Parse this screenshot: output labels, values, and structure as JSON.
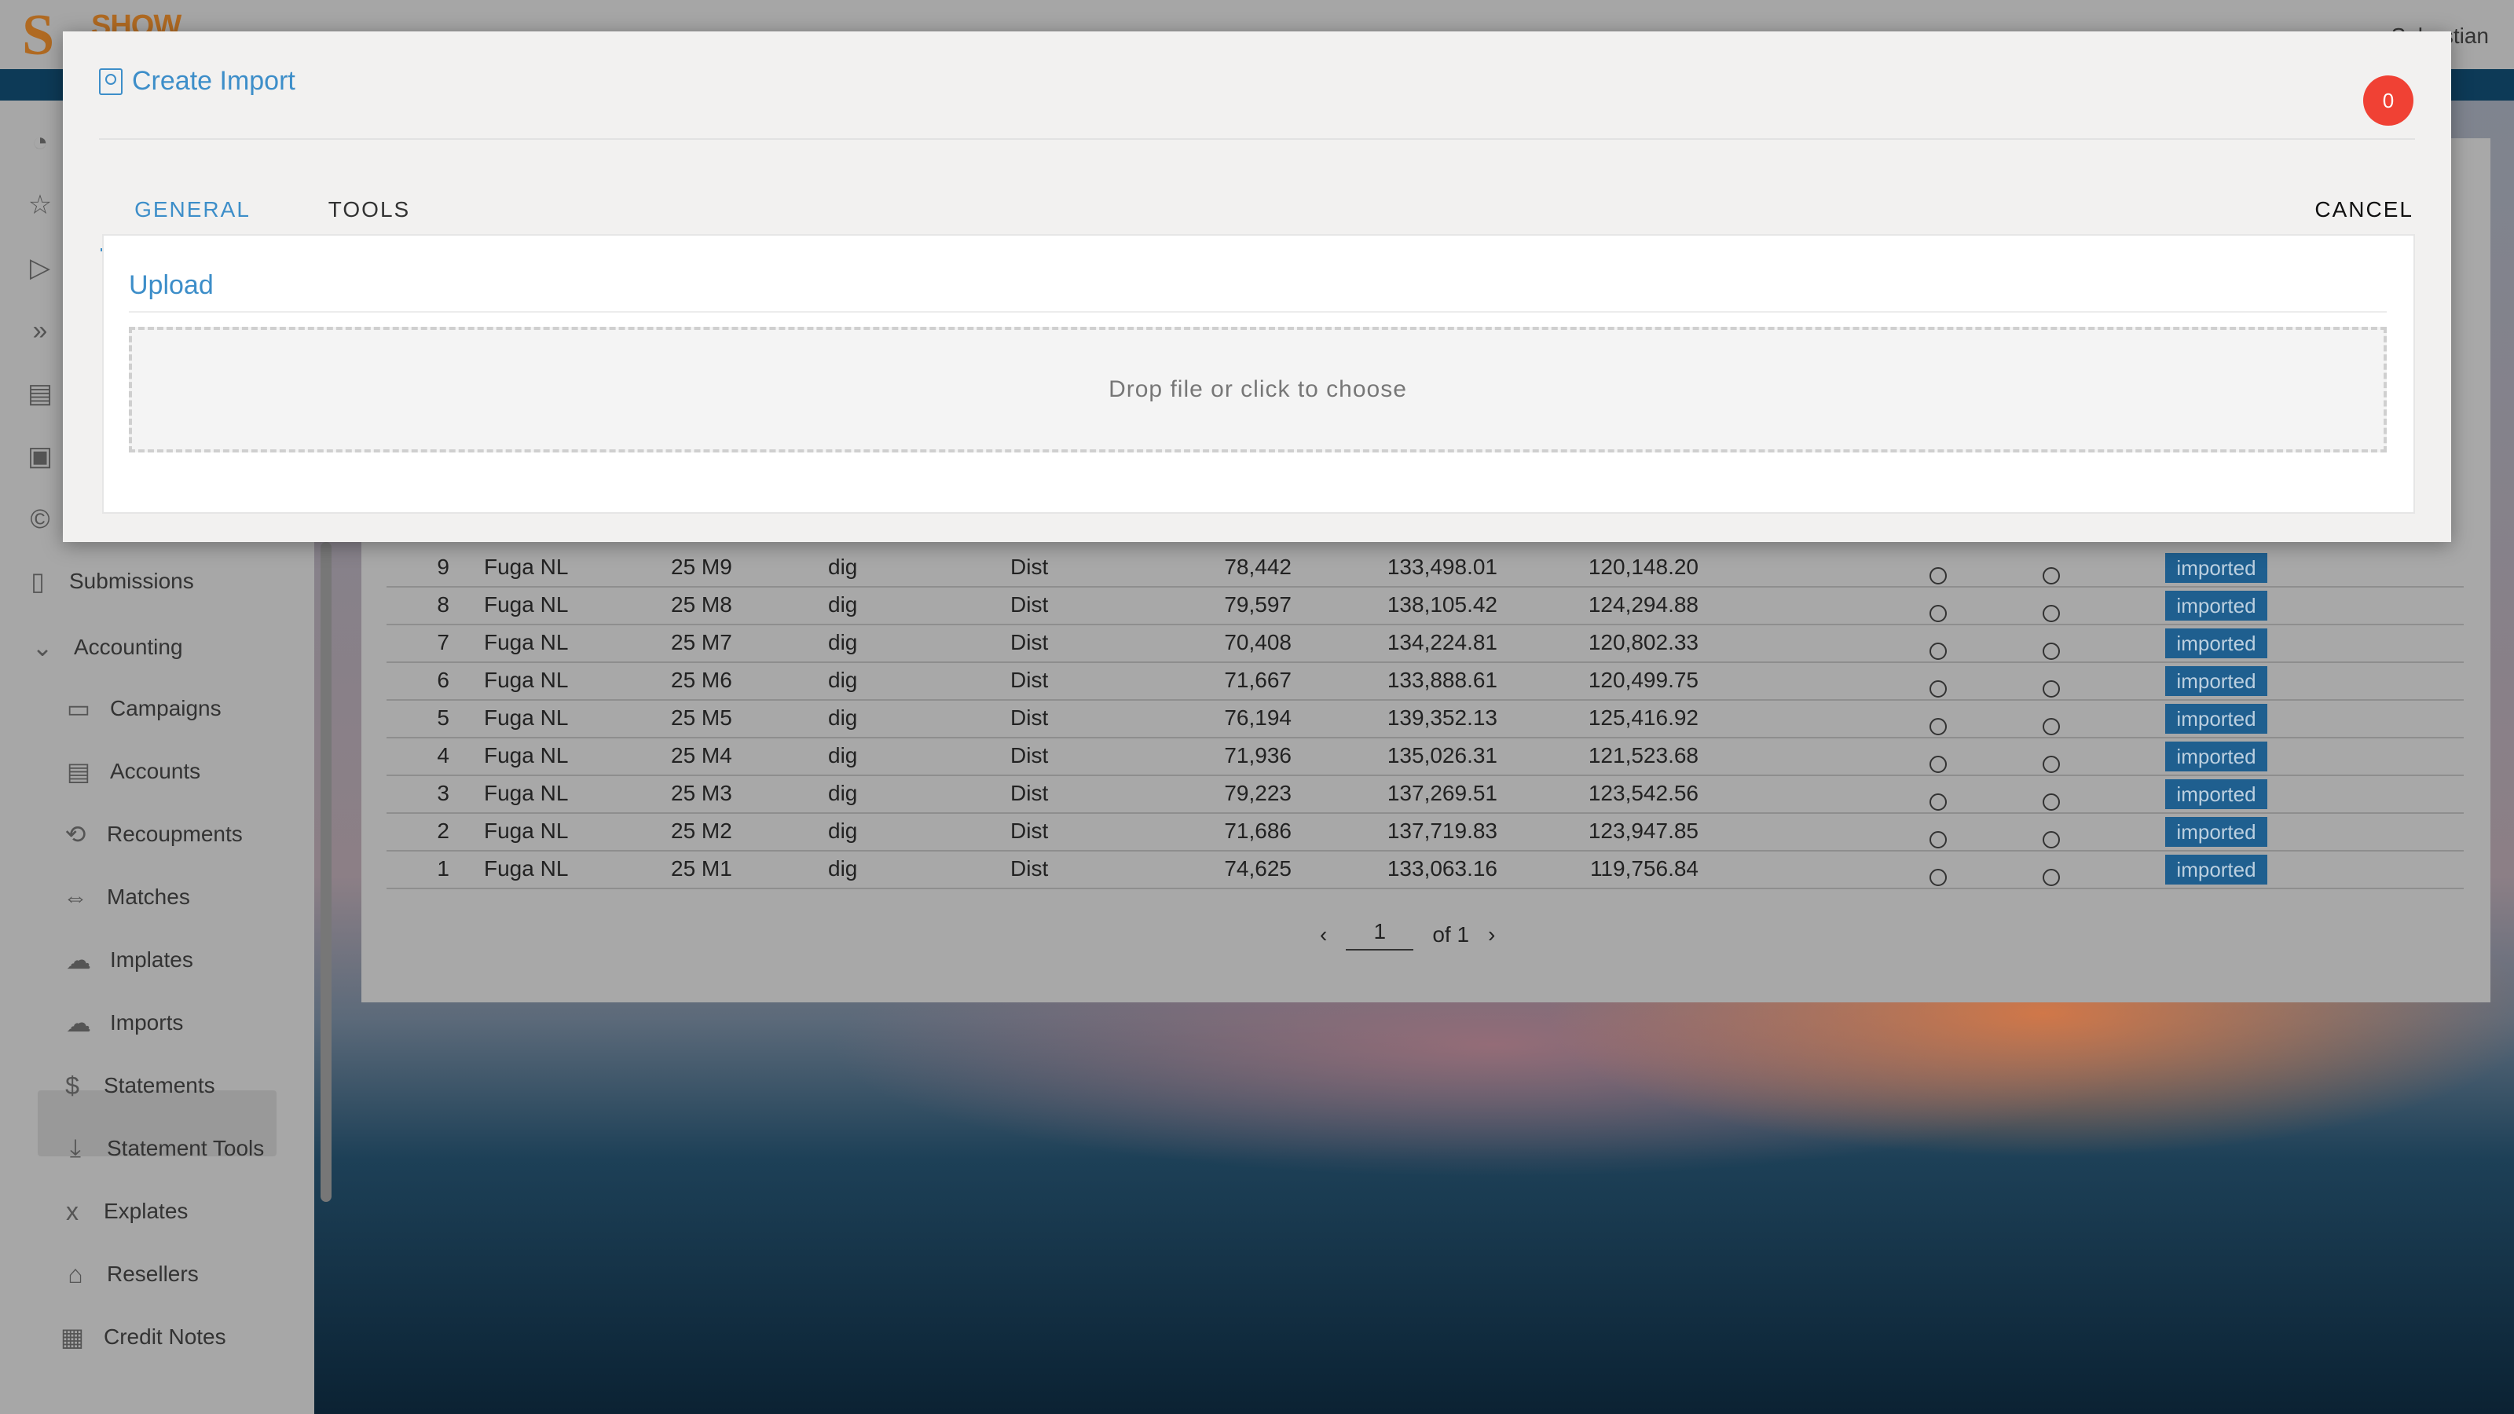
{
  "app": {
    "logo_letter": "S",
    "logo_text": "SHOW",
    "user_name": "Sebastian"
  },
  "sidebar": {
    "items": [
      {
        "label": "Submissions",
        "icon": "document-icon"
      },
      {
        "label": "Accounting",
        "icon": "chevron-down-icon"
      },
      {
        "label": "Campaigns",
        "icon": "monitor-icon"
      },
      {
        "label": "Accounts",
        "icon": "card-icon"
      },
      {
        "label": "Recoupments",
        "icon": "refresh-icon"
      },
      {
        "label": "Matches",
        "icon": "swap-icon"
      },
      {
        "label": "Implates",
        "icon": "cloud-download-icon"
      },
      {
        "label": "Imports",
        "icon": "cloud-download-icon"
      },
      {
        "label": "Statements",
        "icon": "dollar-file-icon"
      },
      {
        "label": "Statement Tools",
        "icon": "dollar-download-icon"
      },
      {
        "label": "Explates",
        "icon": "excel-file-icon"
      },
      {
        "label": "Resellers",
        "icon": "store-icon"
      },
      {
        "label": "Credit Notes",
        "icon": "notes-icon"
      }
    ]
  },
  "table": {
    "rows": [
      {
        "num": "9",
        "label": "Fuga NL",
        "period": "25 M9",
        "format": "dig",
        "type": "Dist",
        "qty": "78,442",
        "gross": "133,498.01",
        "net": "120,148.20",
        "status": "imported"
      },
      {
        "num": "8",
        "label": "Fuga NL",
        "period": "25 M8",
        "format": "dig",
        "type": "Dist",
        "qty": "79,597",
        "gross": "138,105.42",
        "net": "124,294.88",
        "status": "imported"
      },
      {
        "num": "7",
        "label": "Fuga NL",
        "period": "25 M7",
        "format": "dig",
        "type": "Dist",
        "qty": "70,408",
        "gross": "134,224.81",
        "net": "120,802.33",
        "status": "imported"
      },
      {
        "num": "6",
        "label": "Fuga NL",
        "period": "25 M6",
        "format": "dig",
        "type": "Dist",
        "qty": "71,667",
        "gross": "133,888.61",
        "net": "120,499.75",
        "status": "imported"
      },
      {
        "num": "5",
        "label": "Fuga NL",
        "period": "25 M5",
        "format": "dig",
        "type": "Dist",
        "qty": "76,194",
        "gross": "139,352.13",
        "net": "125,416.92",
        "status": "imported"
      },
      {
        "num": "4",
        "label": "Fuga NL",
        "period": "25 M4",
        "format": "dig",
        "type": "Dist",
        "qty": "71,936",
        "gross": "135,026.31",
        "net": "121,523.68",
        "status": "imported"
      },
      {
        "num": "3",
        "label": "Fuga NL",
        "period": "25 M3",
        "format": "dig",
        "type": "Dist",
        "qty": "79,223",
        "gross": "137,269.51",
        "net": "123,542.56",
        "status": "imported"
      },
      {
        "num": "2",
        "label": "Fuga NL",
        "period": "25 M2",
        "format": "dig",
        "type": "Dist",
        "qty": "71,686",
        "gross": "137,719.83",
        "net": "123,947.85",
        "status": "imported"
      },
      {
        "num": "1",
        "label": "Fuga NL",
        "period": "25 M1",
        "format": "dig",
        "type": "Dist",
        "qty": "74,625",
        "gross": "133,063.16",
        "net": "119,756.84",
        "status": "imported"
      }
    ]
  },
  "pagination": {
    "page": "1",
    "of_label": "of 1"
  },
  "dialog": {
    "title": "Create Import",
    "badge_count": "0",
    "tabs": [
      {
        "label": "GENERAL",
        "active": true
      },
      {
        "label": "TOOLS",
        "active": false
      }
    ],
    "cancel_label": "CANCEL",
    "upload": {
      "title": "Upload",
      "dropzone_text": "Drop file or click to choose"
    }
  },
  "colors": {
    "accent": "#3d8ec9",
    "badge": "#f04134",
    "status_badge": "#1f5f8f",
    "brand": "#b06a22"
  }
}
